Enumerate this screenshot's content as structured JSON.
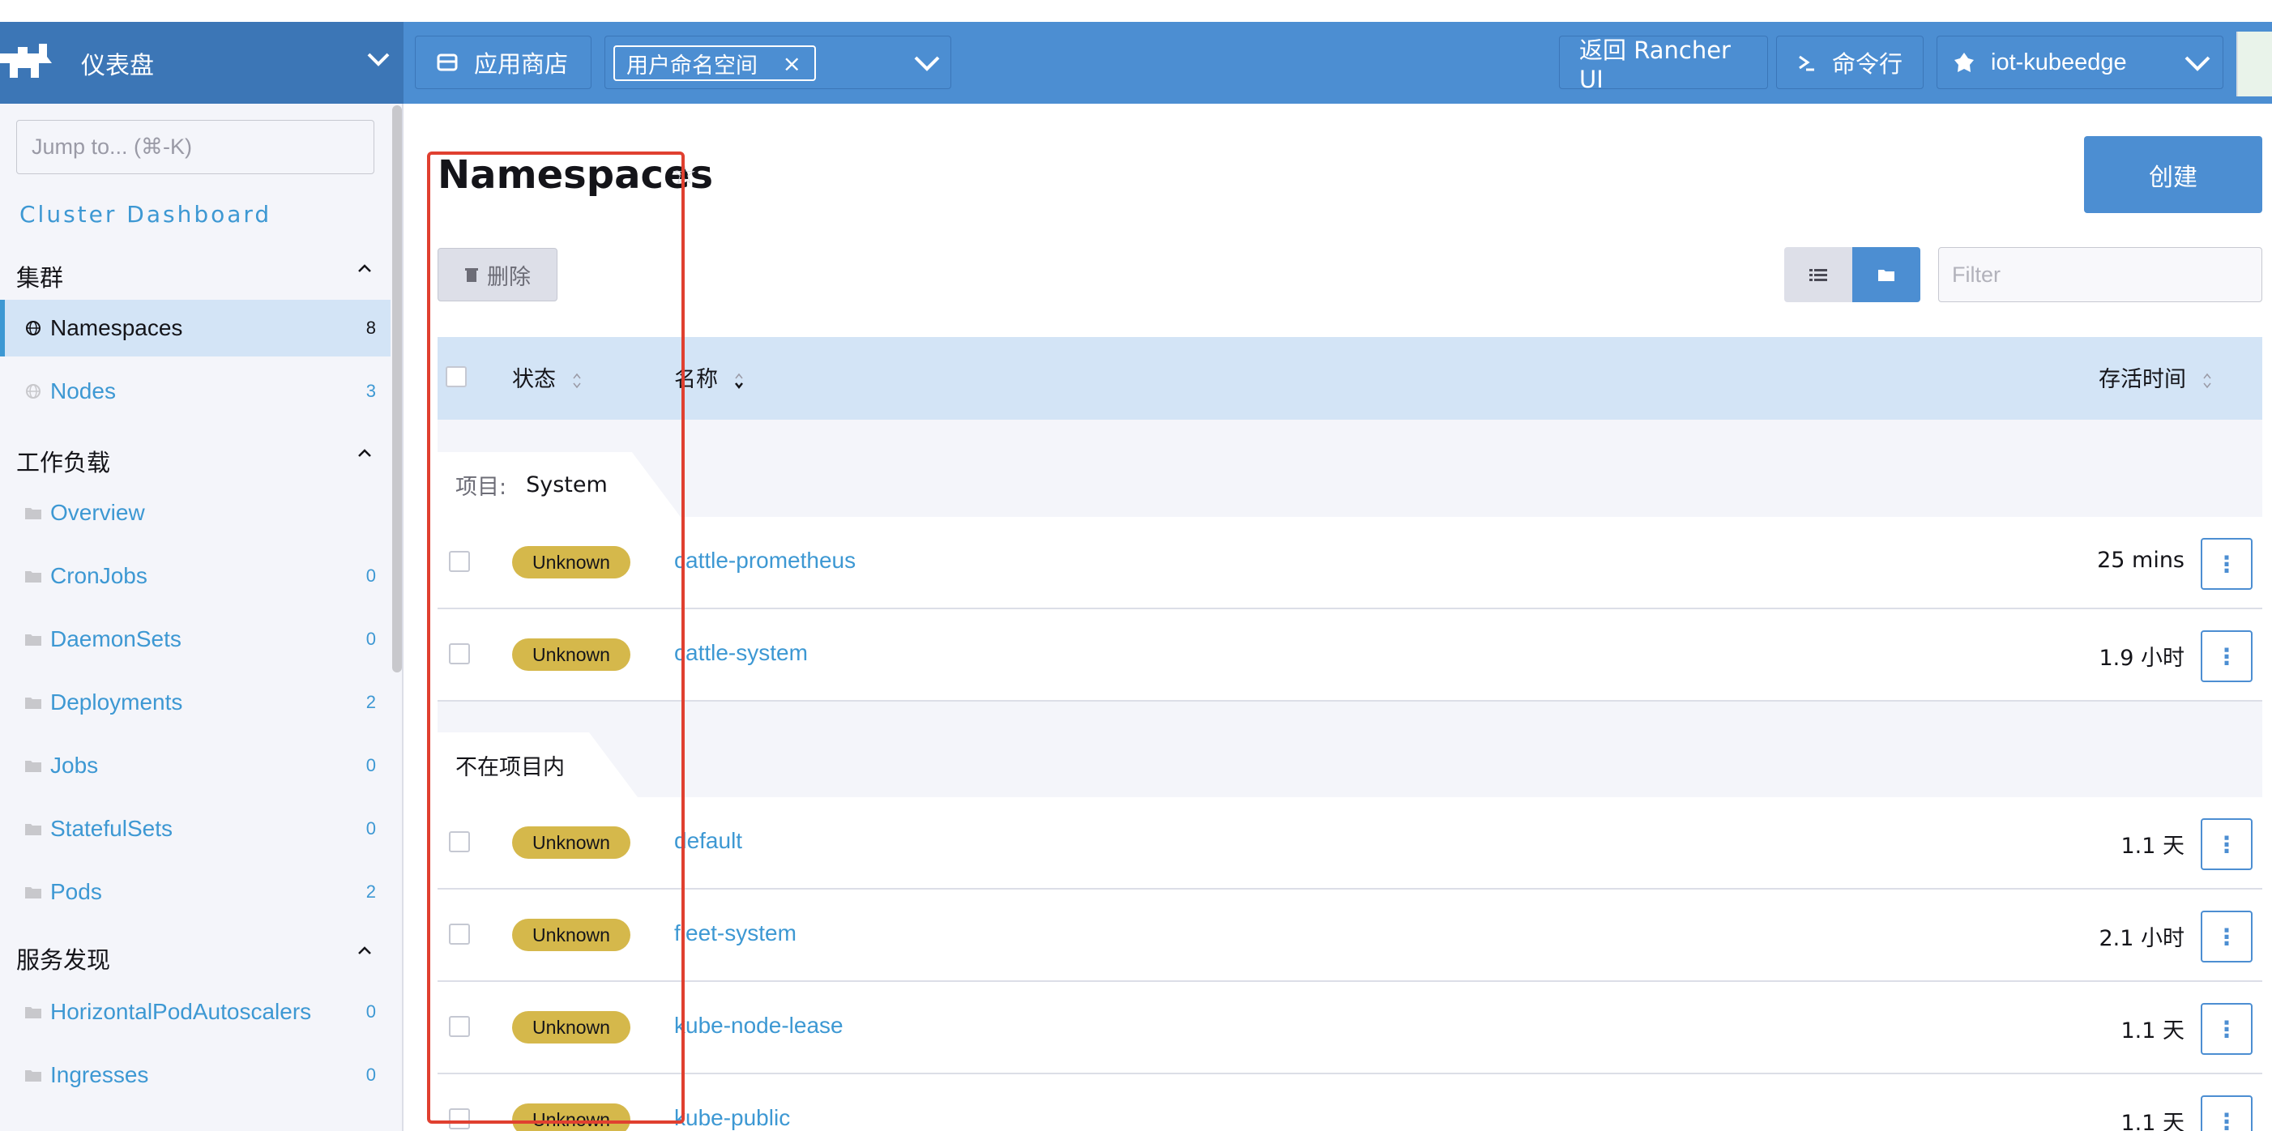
{
  "header": {
    "title": "仪表盘",
    "app_store": "应用商店",
    "ns_chip": "用户命名空间",
    "ns_chip_close": "×",
    "back_rancher": "返回 Rancher UI",
    "shell": "命令行",
    "cluster": "iot-kubeedge"
  },
  "sidebar": {
    "jump_placeholder": "Jump to... (⌘-K)",
    "cluster_dashboard": "Cluster Dashboard",
    "groups": [
      {
        "label": "集群",
        "items": [
          {
            "label": "Namespaces",
            "count": "8"
          },
          {
            "label": "Nodes",
            "count": "3"
          }
        ]
      },
      {
        "label": "工作负载",
        "items": [
          {
            "label": "Overview",
            "count": ""
          },
          {
            "label": "CronJobs",
            "count": "0"
          },
          {
            "label": "DaemonSets",
            "count": "0"
          },
          {
            "label": "Deployments",
            "count": "2"
          },
          {
            "label": "Jobs",
            "count": "0"
          },
          {
            "label": "StatefulSets",
            "count": "0"
          },
          {
            "label": "Pods",
            "count": "2"
          }
        ]
      },
      {
        "label": "服务发现",
        "items": [
          {
            "label": "HorizontalPodAutoscalers",
            "count": "0"
          },
          {
            "label": "Ingresses",
            "count": "0"
          }
        ]
      }
    ]
  },
  "main": {
    "title": "Namespaces",
    "create": "创建",
    "delete": "删除",
    "filter_placeholder": "Filter",
    "columns": {
      "state": "状态",
      "name": "名称",
      "age": "存活时间"
    },
    "groups": [
      {
        "key": "项目:",
        "value": "System"
      },
      {
        "key": "",
        "value": "不在项目内"
      }
    ],
    "rows": [
      {
        "state": "Unknown",
        "name": "cattle-prometheus",
        "age": "25 mins"
      },
      {
        "state": "Unknown",
        "name": "cattle-system",
        "age": "1.9 小时"
      },
      {
        "state": "Unknown",
        "name": "default",
        "age": "1.1 天"
      },
      {
        "state": "Unknown",
        "name": "fleet-system",
        "age": "2.1 小时"
      },
      {
        "state": "Unknown",
        "name": "kube-node-lease",
        "age": "1.1 天"
      },
      {
        "state": "Unknown",
        "name": "kube-public",
        "age": "1.1 天"
      }
    ],
    "menu_glyph": "⋮"
  }
}
